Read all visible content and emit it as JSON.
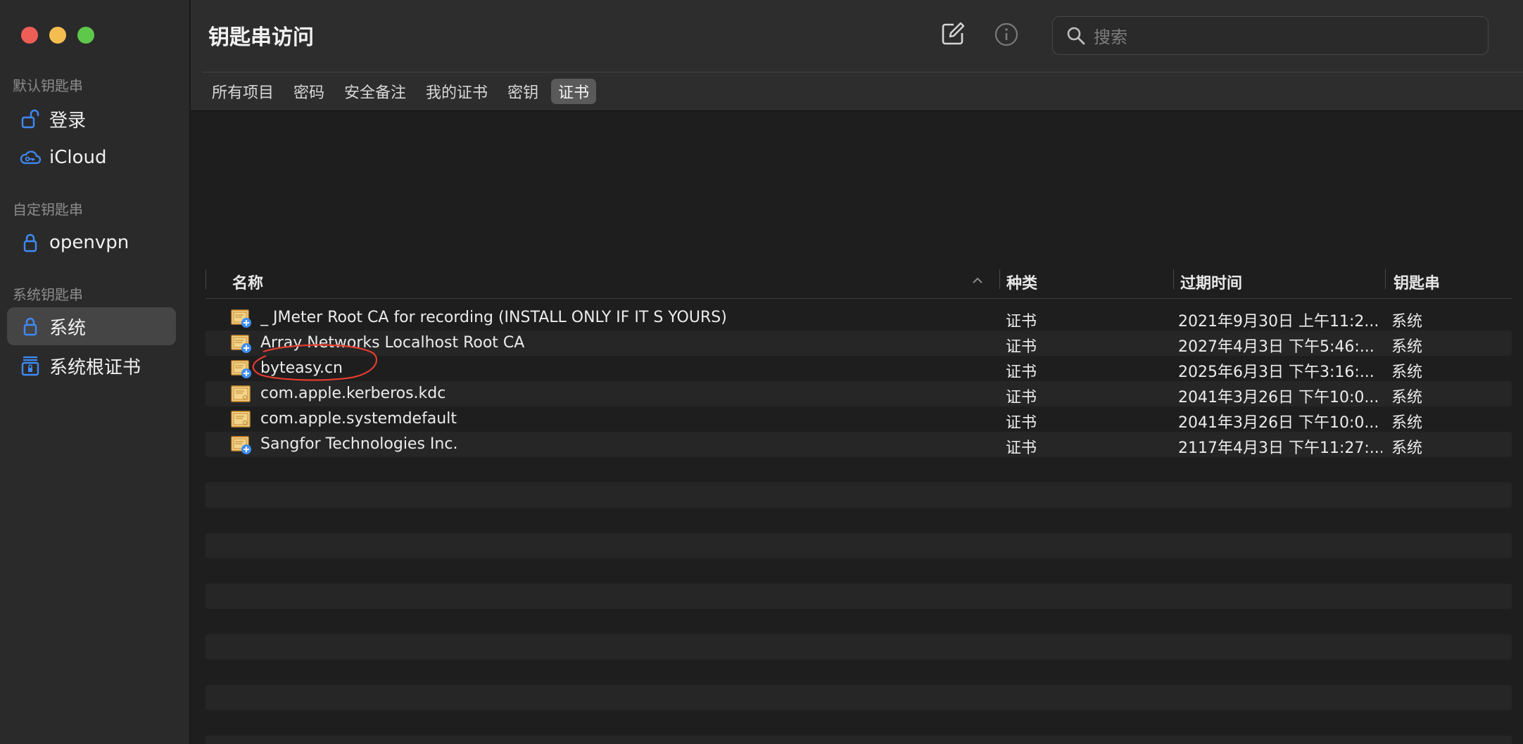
{
  "window": {
    "title": "钥匙串访问"
  },
  "sidebar": {
    "sections": [
      {
        "title": "默认钥匙串",
        "items": [
          {
            "label": "登录",
            "icon": "lock-open-icon"
          },
          {
            "label": "iCloud",
            "icon": "cloud-key-icon"
          }
        ]
      },
      {
        "title": "自定钥匙串",
        "items": [
          {
            "label": "openvpn",
            "icon": "lock-icon"
          }
        ]
      },
      {
        "title": "系统钥匙串",
        "items": [
          {
            "label": "系统",
            "icon": "lock-icon",
            "selected": true
          },
          {
            "label": "系统根证书",
            "icon": "cabinet-lock-icon"
          }
        ]
      }
    ]
  },
  "search": {
    "placeholder": "搜索"
  },
  "tabs": [
    "所有项目",
    "密码",
    "安全备注",
    "我的证书",
    "密钥",
    "证书"
  ],
  "active_tab": "证书",
  "table": {
    "columns": [
      "名称",
      "种类",
      "过期时间",
      "钥匙串"
    ],
    "rows": [
      {
        "name": "_ JMeter Root CA for recording (INSTALL ONLY IF IT S YOURS)",
        "kind": "证书",
        "expires": "2021年9月30日 上午11:2...",
        "keychain": "系统",
        "icon": "certificate-plus-icon"
      },
      {
        "name": "Array Networks Localhost Root CA",
        "kind": "证书",
        "expires": "2027年4月3日 下午5:46:...",
        "keychain": "系统",
        "icon": "certificate-plus-icon"
      },
      {
        "name": "byteasy.cn",
        "kind": "证书",
        "expires": "2025年6月3日 下午3:16:...",
        "keychain": "系统",
        "icon": "certificate-plus-icon"
      },
      {
        "name": "com.apple.kerberos.kdc",
        "kind": "证书",
        "expires": "2041年3月26日 下午10:0...",
        "keychain": "系统",
        "icon": "certificate-icon"
      },
      {
        "name": "com.apple.systemdefault",
        "kind": "证书",
        "expires": "2041年3月26日 下午10:0...",
        "keychain": "系统",
        "icon": "certificate-icon"
      },
      {
        "name": "Sangfor Technologies Inc.",
        "kind": "证书",
        "expires": "2117年4月3日 下午11:27:...",
        "keychain": "系统",
        "icon": "certificate-plus-icon"
      }
    ]
  },
  "colors": {
    "close": "#ee5e56",
    "minimize": "#f4bd4f",
    "zoom": "#5ec84a",
    "accent": "#3e8bf7",
    "annotation": "#e23c2e"
  }
}
